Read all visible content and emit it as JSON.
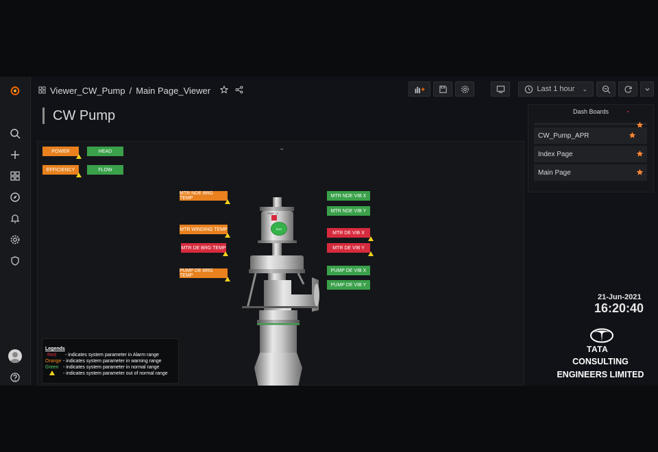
{
  "breadcrumb": {
    "folder": "Viewer_CW_Pump",
    "separator": "/",
    "dashboard": "Main Page_Viewer"
  },
  "toolbar": {
    "time_range": "Last 1 hour"
  },
  "page_title": "CW Pump",
  "indicators": [
    {
      "label": "POWER",
      "status": "orange",
      "warning": true
    },
    {
      "label": "HEAD",
      "status": "green",
      "warning": false
    },
    {
      "label": "EFFICIENCY",
      "status": "orange",
      "warning": true
    },
    {
      "label": "FLOW",
      "status": "green",
      "warning": false
    },
    {
      "label": "MTR NDE BRG TEMP",
      "status": "orange",
      "warning": true
    },
    {
      "label": "MTR WINDING  TEMP",
      "status": "orange",
      "warning": true
    },
    {
      "label": "MTR DE BRG TEMP",
      "status": "red",
      "warning": true
    },
    {
      "label": "PUMP DE BRG TEMP",
      "status": "orange",
      "warning": true
    },
    {
      "label": "MTR NDE VIB X",
      "status": "green",
      "warning": false
    },
    {
      "label": "MTR NDE VIB Y",
      "status": "green",
      "warning": false
    },
    {
      "label": "MTR DE VIB X",
      "status": "red",
      "warning": true
    },
    {
      "label": "MTR  DE VIB Y",
      "status": "red",
      "warning": true
    },
    {
      "label": "PUMP  DE VIB X",
      "status": "green",
      "warning": false
    },
    {
      "label": "PUMP  DE VIB Y",
      "status": "green",
      "warning": false
    }
  ],
  "pump": {
    "tag": "CWP - 1",
    "run_label": "RUN"
  },
  "legend": {
    "title": "Legends",
    "rows": [
      {
        "key": "Red",
        "text": "- indicates system parameter in Alarm range",
        "color": "#e02f44"
      },
      {
        "key": "Orange",
        "text": "- indicates system parameter in warning range",
        "color": "#ff8c1a"
      },
      {
        "key": "Green",
        "text": "- indicates system parameter in normal range",
        "color": "#56d364"
      },
      {
        "key": "",
        "text": "- indicates system parameter out of normal range",
        "color": "#f2d21d"
      }
    ]
  },
  "dashboards": {
    "title": "Dash Boards",
    "items": [
      "CW_Pump_APR",
      "Index Page",
      "Main Page"
    ]
  },
  "datetime": {
    "date": "21-Jun-2021",
    "time": "16:20:40"
  },
  "branding": {
    "logo_word": "TATA",
    "line1": "CONSULTING",
    "line2": "ENGINEERS LIMITED"
  },
  "colors": {
    "orange": "#e8811e",
    "green": "#3aa14a",
    "red": "#d72b3d",
    "warning": "#f2d21d",
    "star": "#ff8833"
  }
}
